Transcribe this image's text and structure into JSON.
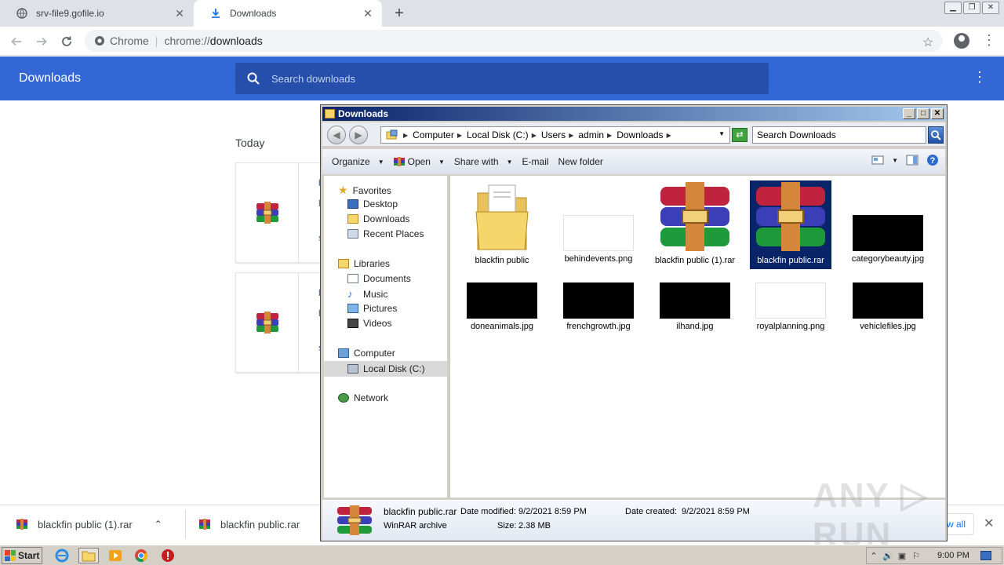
{
  "chrome": {
    "tabs": [
      {
        "title": "srv-file9.gofile.io",
        "icon": "globe-icon"
      },
      {
        "title": "Downloads",
        "icon": "download-icon"
      }
    ],
    "close_glyph": "✕",
    "new_tab_glyph": "+",
    "window_controls": [
      "▁",
      "❐",
      "✕"
    ],
    "omnibox": {
      "site_label": "Chrome",
      "separator": "|",
      "url_scheme": "chrome://",
      "url_path": "downloads"
    }
  },
  "downloads_page": {
    "title": "Downloads",
    "search_placeholder": "Search downloads",
    "section_label": "Today",
    "card_fragments": [
      {
        "line1": "b",
        "line2": "h",
        "line3": "s"
      },
      {
        "line1": "b",
        "line2": "h",
        "line3": "s"
      }
    ]
  },
  "shelf": {
    "items": [
      {
        "name": "blackfin public (1).rar"
      },
      {
        "name": "blackfin public.rar"
      }
    ],
    "chevron": "⌃",
    "show_all_label": "w all",
    "close_glyph": "✕"
  },
  "explorer": {
    "title": "Downloads",
    "window_buttons": [
      "_",
      "□",
      "✕"
    ],
    "breadcrumb": [
      "Computer",
      "Local Disk (C:)",
      "Users",
      "admin",
      "Downloads"
    ],
    "search_placeholder": "Search Downloads",
    "commands": [
      {
        "label": "Organize",
        "dropdown": true
      },
      {
        "label": "Open",
        "dropdown": true
      },
      {
        "label": "Share with",
        "dropdown": true
      },
      {
        "label": "E-mail",
        "dropdown": false
      },
      {
        "label": "New folder",
        "dropdown": false
      }
    ],
    "nav": {
      "favorites": "Favorites",
      "favorites_items": [
        "Desktop",
        "Downloads",
        "Recent Places"
      ],
      "libraries": "Libraries",
      "libraries_items": [
        "Documents",
        "Music",
        "Pictures",
        "Videos"
      ],
      "computer": "Computer",
      "computer_items": [
        "Local Disk (C:)"
      ],
      "network": "Network"
    },
    "files": [
      {
        "name": "blackfin public",
        "kind": "folder",
        "selected": false
      },
      {
        "name": "behindevents.png",
        "kind": "white-image",
        "selected": false
      },
      {
        "name": "blackfin public (1).rar",
        "kind": "rar",
        "selected": false
      },
      {
        "name": "blackfin public.rar",
        "kind": "rar",
        "selected": true
      },
      {
        "name": "categorybeauty.jpg",
        "kind": "black-image",
        "selected": false
      },
      {
        "name": "doneanimals.jpg",
        "kind": "black-image",
        "selected": false
      },
      {
        "name": "frenchgrowth.jpg",
        "kind": "black-image",
        "selected": false
      },
      {
        "name": "ilhand.jpg",
        "kind": "black-image",
        "selected": false
      },
      {
        "name": "royalplanning.png",
        "kind": "white-image",
        "selected": false
      },
      {
        "name": "vehiclefiles.jpg",
        "kind": "black-image",
        "selected": false
      }
    ],
    "details": {
      "name": "blackfin public.rar",
      "type": "WinRAR archive",
      "modified_label": "Date modified:",
      "modified_value": "9/2/2021 8:59 PM",
      "size_label": "Size:",
      "size_value": "2.38 MB",
      "created_label": "Date created:",
      "created_value": "9/2/2021 8:59 PM"
    }
  },
  "taskbar": {
    "start_label": "Start",
    "clock": "9:00 PM",
    "tray_icons": [
      "⌃",
      "🔊",
      "▣",
      "⚐"
    ]
  },
  "watermark": "ANY ▷ RUN",
  "colors": {
    "chrome_blue": "#3367d6",
    "search_bg": "#254fab",
    "explorer_title": "#0a246a",
    "selection": "#0a246a"
  }
}
